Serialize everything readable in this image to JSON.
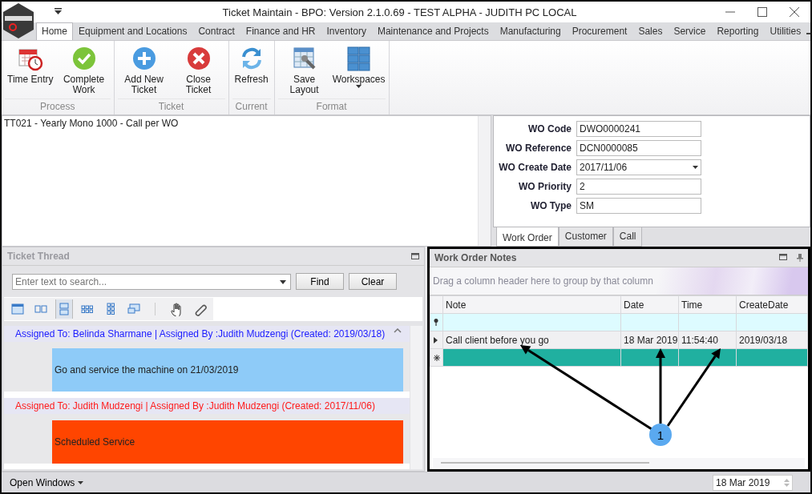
{
  "window": {
    "title": "Ticket Maintain - BPO: Version 2.1.0.69 - TEST ALPHA - JUDITH PC LOCAL"
  },
  "menu_tabs": [
    {
      "label": "Home",
      "selected": true
    },
    {
      "label": "Equipment and Locations",
      "selected": false
    },
    {
      "label": "Contract",
      "selected": false
    },
    {
      "label": "Finance and HR",
      "selected": false
    },
    {
      "label": "Inventory",
      "selected": false
    },
    {
      "label": "Maintenance and Projects",
      "selected": false
    },
    {
      "label": "Manufacturing",
      "selected": false
    },
    {
      "label": "Procurement",
      "selected": false
    },
    {
      "label": "Sales",
      "selected": false
    },
    {
      "label": "Service",
      "selected": false
    },
    {
      "label": "Reporting",
      "selected": false
    },
    {
      "label": "Utilities",
      "selected": false
    }
  ],
  "ribbon_groups": [
    {
      "label": "Process",
      "buttons": [
        {
          "label": "Time Entry",
          "kind": "calendar",
          "dropdown": false
        },
        {
          "label": "Complete Work",
          "kind": "check",
          "dropdown": false
        }
      ]
    },
    {
      "label": "Ticket",
      "buttons": [
        {
          "label": "Add New Ticket",
          "kind": "plus",
          "dropdown": false
        },
        {
          "label": "Close Ticket",
          "kind": "cross",
          "dropdown": false
        }
      ]
    },
    {
      "label": "Current",
      "buttons": [
        {
          "label": "Refresh",
          "kind": "refresh",
          "dropdown": false
        }
      ]
    },
    {
      "label": "Format",
      "buttons": [
        {
          "label": "Save Layout",
          "kind": "layout",
          "dropdown": false
        },
        {
          "label": "Workspaces",
          "kind": "tiles",
          "dropdown": true
        }
      ]
    }
  ],
  "description": "TT021 - Yearly Mono 1000 - Call per WO",
  "work_order_form": {
    "fields": [
      {
        "label": "WO Code",
        "value": "DWO0000241",
        "kind": "text"
      },
      {
        "label": "WO Reference",
        "value": "DCN0000085",
        "kind": "text"
      },
      {
        "label": "WO Create Date",
        "value": "2017/11/06",
        "kind": "date"
      },
      {
        "label": "WO Priority",
        "value": "2",
        "kind": "text"
      },
      {
        "label": "WO Type",
        "value": "SM",
        "kind": "text"
      }
    ],
    "tabs": [
      {
        "label": "Work Order",
        "selected": true
      },
      {
        "label": "Customer",
        "selected": false
      },
      {
        "label": "Call",
        "selected": false
      }
    ]
  },
  "ticket_thread": {
    "title": "Ticket Thread",
    "search": {
      "placeholder": "Enter text to search..."
    },
    "buttons": [
      "Find",
      "Clear"
    ],
    "view_buttons": [
      {
        "kind": "window",
        "selected": false
      },
      {
        "kind": "columns",
        "selected": false
      },
      {
        "kind": "rows",
        "selected": true
      },
      {
        "kind": "grid6",
        "selected": false
      },
      {
        "kind": "grid4",
        "selected": false
      },
      {
        "kind": "monitor",
        "selected": false
      },
      {
        "kind": "hand",
        "selected": false
      },
      {
        "kind": "link",
        "selected": false
      }
    ],
    "entries": [
      {
        "header": {
          "text": "Assigned To: Belinda Sharmane | Assigned By :Judith Mudzengi (Created: 2019/03/18)",
          "color": "#1a1aff"
        },
        "body": "Go and service the machine on 21/03/2019",
        "color": "#8ecbf8"
      },
      {
        "header": {
          "text": "Assigned To: Judith Mudzengi | Assigned By :Judith Mudzengi (Created: 2017/11/06)",
          "color": "#ff1a1a"
        },
        "body": "Scheduled Service",
        "color": "#ff4500"
      }
    ]
  },
  "notes": {
    "title": "Work Order Notes",
    "group_hint": "Drag a column header here to group by that column",
    "columns": [
      "Note",
      "Date",
      "Time",
      "CreateDate"
    ],
    "rows": [
      {
        "cells": [
          "Call client before you go",
          "18 Mar 2019",
          "11:54:40",
          "2019/03/18"
        ],
        "focused": true
      }
    ],
    "callout": "1"
  },
  "status_bar": {
    "open_windows": "Open Windows",
    "date": "18 Mar 2019"
  }
}
